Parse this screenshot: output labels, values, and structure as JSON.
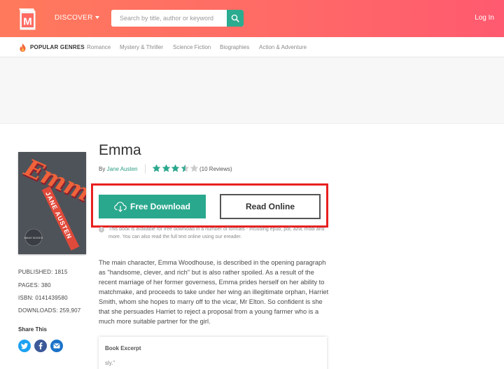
{
  "header": {
    "logo_letter": "M",
    "discover_label": "DISCOVER",
    "search_placeholder": "Search by title, author or keyword",
    "login_label": "Log In"
  },
  "genres": {
    "title": "POPULAR GENRES",
    "items": [
      "Romance",
      "Mystery & Thriller",
      "Science Fiction",
      "Biographies",
      "Action & Adventure"
    ]
  },
  "book": {
    "title": "Emma",
    "by_label": "By",
    "author": "Jane Austen",
    "rating": 3.5,
    "reviews": "(10 Reviews)",
    "cover_title": "Emma",
    "cover_author": "JANE AUSTEN",
    "cover_badge": "MANY BOOKS"
  },
  "actions": {
    "download_label": "Free Download",
    "read_label": "Read Online"
  },
  "info_note": "This book is available for free download in a number of formats - including epub, pdf, azw, mobi and more. You can also read the full text online using our ereader.",
  "description": "The main character, Emma Woodhouse, is described in the opening paragraph as \"handsome, clever, and rich\" but is also rather spoiled. As a result of the recent marriage of her former governess, Emma prides herself on her ability to matchmake, and proceeds to take under her wing an illegitimate orphan, Harriet Smith, whom she hopes to marry off to the vicar, Mr Elton. So confident is she that she persuades Harriet to reject a proposal from a young farmer who is a much more suitable partner for the girl.",
  "meta": {
    "published": "PUBLISHED: 1815",
    "pages": "PAGES: 380",
    "isbn": "ISBN: 0141439580",
    "downloads": "DOWNLOADS: 259,907"
  },
  "share": {
    "title": "Share This",
    "icons": [
      "twitter-icon",
      "facebook-icon",
      "email-icon"
    ]
  },
  "excerpt": {
    "title": "Book Excerpt",
    "text": "sly.\""
  },
  "colors": {
    "header_start": "#ff7a5c",
    "header_end": "#ff5a70",
    "accent_green": "#2aa88d",
    "star_filled": "#2aa88d",
    "star_empty": "#cccccc",
    "highlight_red": "#e8201f",
    "share_blue": "#1da1f2"
  }
}
